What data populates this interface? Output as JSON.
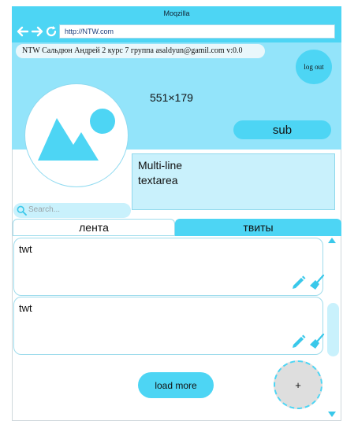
{
  "window": {
    "title": "Moqzilla"
  },
  "browser": {
    "url": "http://NTW.com"
  },
  "header": {
    "user_info": "NTW Сальдюн Андрей 2 курс 7 группа  asaldyun@gamil.com  v:0.0",
    "logout_label": "log out",
    "image_dims": "551×179",
    "sub_label": "sub"
  },
  "compose": {
    "text": "Multi-line\ntextarea"
  },
  "search": {
    "placeholder": "Search..."
  },
  "tabs": [
    {
      "label": "лента",
      "active": false
    },
    {
      "label": "твиты",
      "active": true
    }
  ],
  "tweets": [
    {
      "text": "twt"
    },
    {
      "text": "twt"
    }
  ],
  "feed": {
    "load_more_label": "load more",
    "add_label": "+"
  },
  "colors": {
    "accent": "#4dd5f4",
    "header_bg": "#93e4fa",
    "light": "#c9f1fc"
  }
}
